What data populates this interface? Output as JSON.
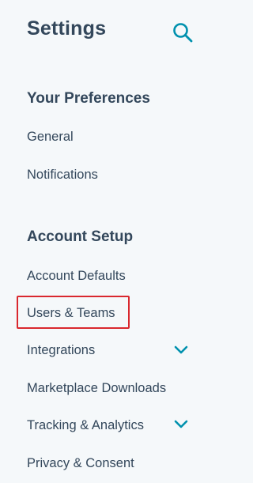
{
  "header": {
    "title": "Settings",
    "search_icon": "search-icon"
  },
  "sections": [
    {
      "header": "Your Preferences",
      "items": [
        {
          "label": "General"
        },
        {
          "label": "Notifications"
        }
      ]
    },
    {
      "header": "Account Setup",
      "items": [
        {
          "label": "Account Defaults"
        },
        {
          "label": "Users & Teams",
          "highlighted": true
        },
        {
          "label": "Integrations",
          "expandable": true,
          "icon": "chevron-down-icon"
        },
        {
          "label": "Marketplace Downloads"
        },
        {
          "label": "Tracking & Analytics",
          "expandable": true,
          "icon": "chevron-down-icon"
        },
        {
          "label": "Privacy & Consent"
        }
      ]
    }
  ],
  "colors": {
    "background": "#f5f8fa",
    "text": "#33475b",
    "accent": "#0091ae",
    "highlight_border": "#d9282e"
  }
}
